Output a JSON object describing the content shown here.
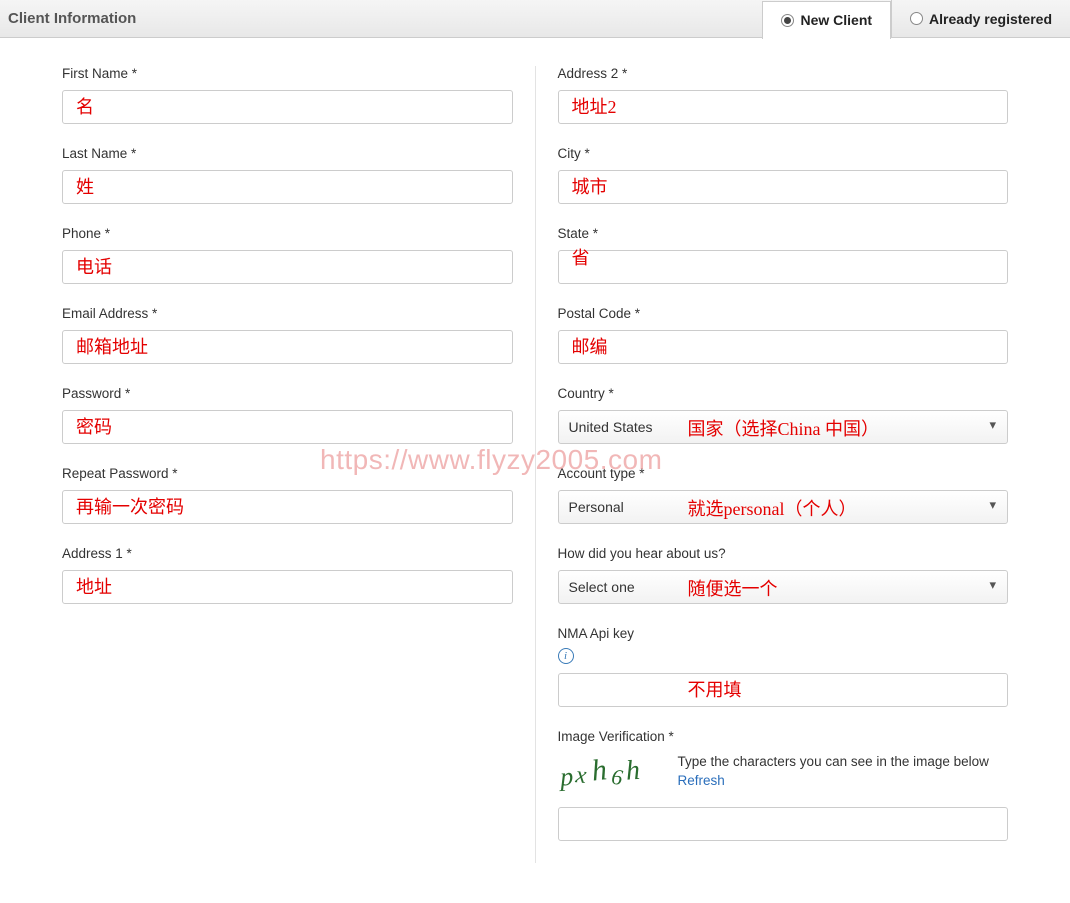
{
  "header": {
    "title": "Client Information",
    "tabs": {
      "new_client": "New Client",
      "already_registered": "Already registered"
    }
  },
  "left": {
    "first_name": {
      "label": "First Name *",
      "annot": "名"
    },
    "last_name": {
      "label": "Last Name *",
      "annot": "姓"
    },
    "phone": {
      "label": "Phone *",
      "annot": "电话"
    },
    "email": {
      "label": "Email Address *",
      "annot": "邮箱地址"
    },
    "password": {
      "label": "Password *",
      "annot": "密码"
    },
    "repeat_password": {
      "label": "Repeat Password *",
      "annot": "再输一次密码"
    },
    "address1": {
      "label": "Address 1 *",
      "annot": "地址"
    }
  },
  "right": {
    "address2": {
      "label": "Address 2 *",
      "annot": "地址2"
    },
    "city": {
      "label": "City *",
      "annot": "城市"
    },
    "state": {
      "label": "State *",
      "annot": "省"
    },
    "postal_code": {
      "label": "Postal Code *",
      "annot": "邮编"
    },
    "country": {
      "label": "Country *",
      "value": "United States",
      "annot": "国家（选择China 中国）"
    },
    "account_type": {
      "label": "Account type *",
      "value": "Personal",
      "annot": "就选personal（个人）"
    },
    "hear_about": {
      "label": "How did you hear about us?",
      "value": "Select one",
      "annot": "随便选一个"
    },
    "nma": {
      "label": "NMA Api key",
      "annot": "不用填"
    },
    "captcha": {
      "label": "Image Verification *",
      "captcha_text": "pxh6h",
      "instructions": "Type the characters you can see in the image below",
      "refresh": "Refresh"
    }
  },
  "watermark": "https://www.flyzy2005.com"
}
